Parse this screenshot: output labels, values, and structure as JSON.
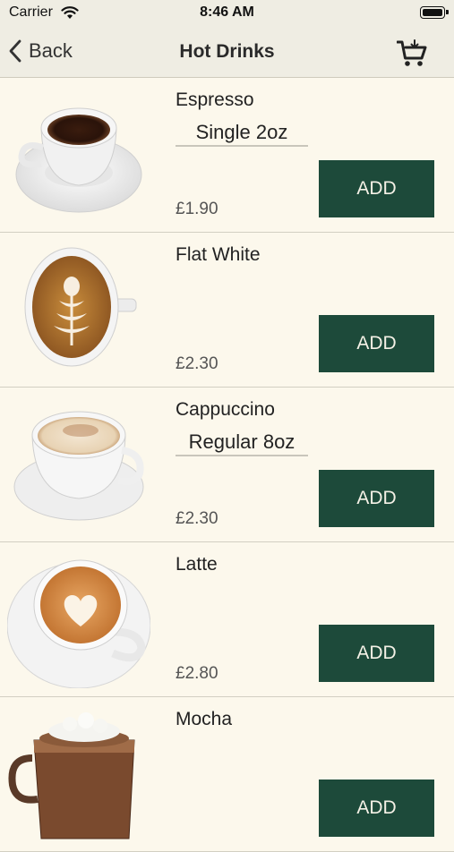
{
  "status_bar": {
    "carrier": "Carrier",
    "time": "8:46 AM"
  },
  "nav": {
    "back_label": "Back",
    "title": "Hot Drinks"
  },
  "products": [
    {
      "name": "Espresso",
      "option": "Single 2oz",
      "price": "£1.90",
      "add_label": "ADD"
    },
    {
      "name": "Flat White",
      "option": "",
      "price": "£2.30",
      "add_label": "ADD"
    },
    {
      "name": "Cappuccino",
      "option": "Regular 8oz",
      "price": "£2.30",
      "add_label": "ADD"
    },
    {
      "name": "Latte",
      "option": "",
      "price": "£2.80",
      "add_label": "ADD"
    },
    {
      "name": "Mocha",
      "option": "",
      "price": "",
      "add_label": "ADD"
    }
  ],
  "colors": {
    "background": "#fcf8ec",
    "bar": "#efede3",
    "button": "#1d4a3a"
  }
}
